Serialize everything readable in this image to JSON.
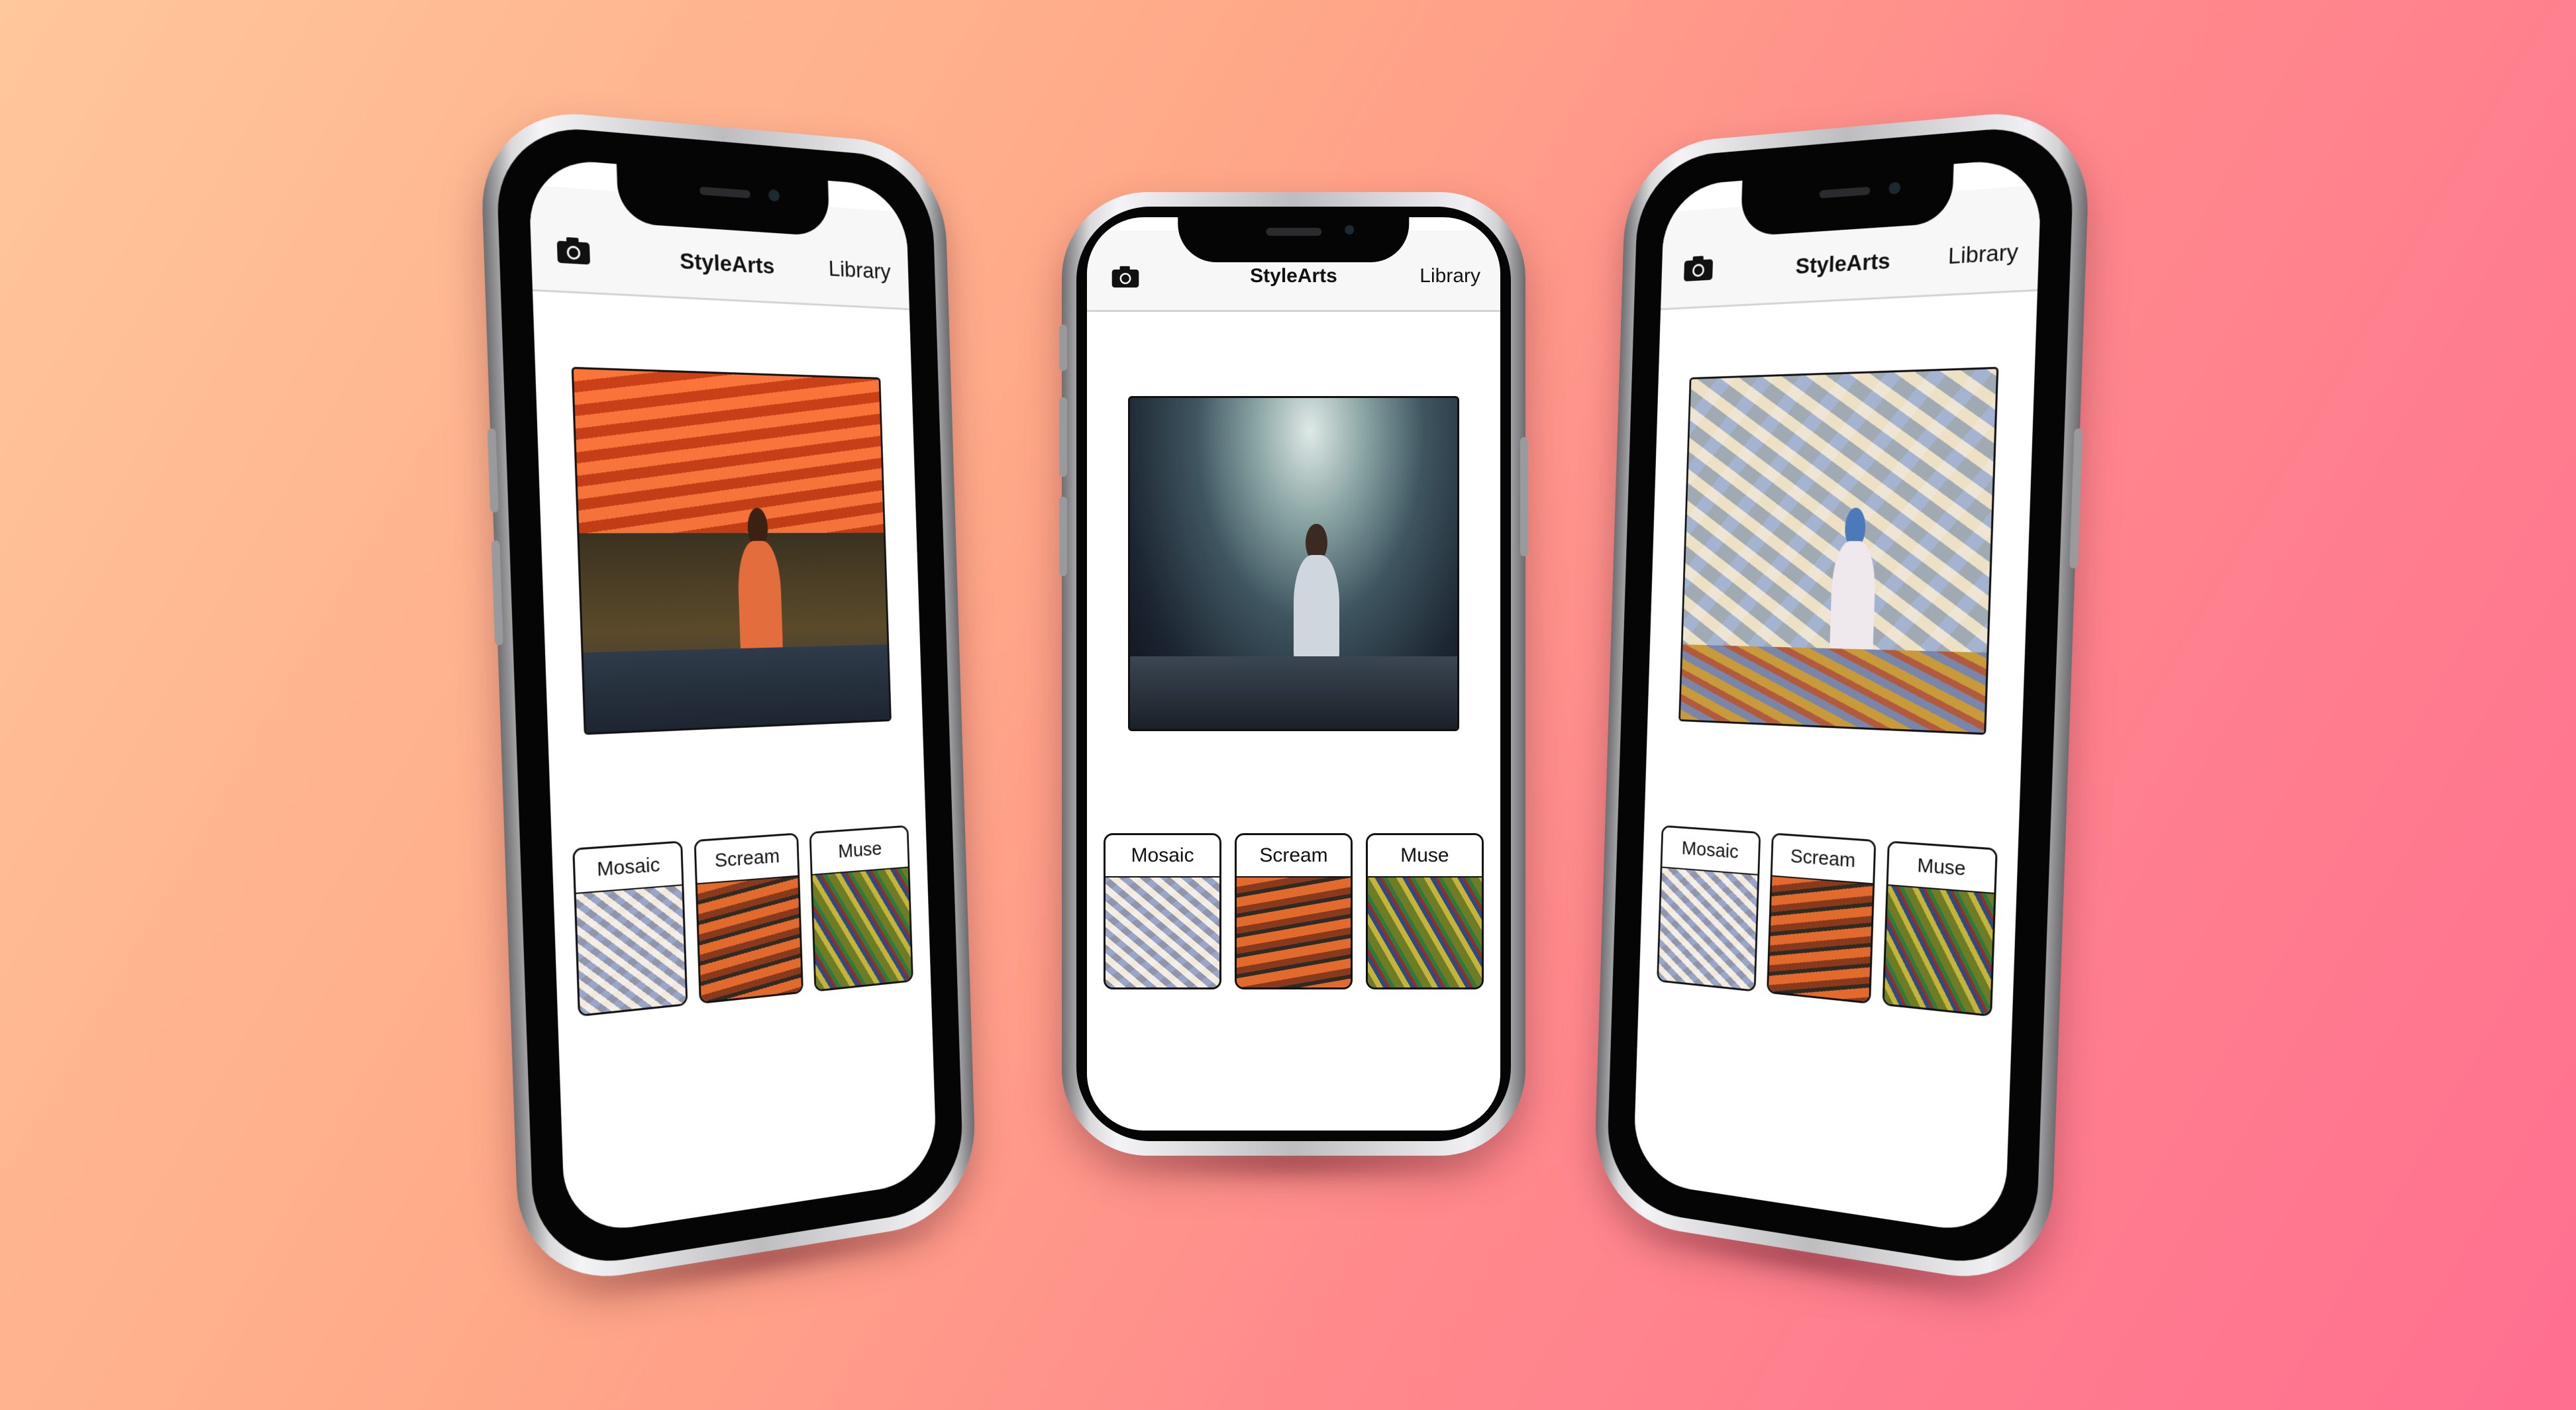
{
  "app": {
    "title": "StyleArts",
    "library_label": "Library",
    "camera_icon": "camera-icon"
  },
  "style_options": [
    {
      "label": "Mosaic"
    },
    {
      "label": "Scream"
    },
    {
      "label": "Muse"
    }
  ],
  "phones": [
    {
      "id": "left",
      "applied_style": "Scream"
    },
    {
      "id": "center",
      "applied_style": ""
    },
    {
      "id": "right",
      "applied_style": "Mosaic"
    }
  ],
  "colors": {
    "background_start": "#ffc79a",
    "background_end": "#ff6f90",
    "nav_background": "#f7f7f7",
    "text": "#111111"
  }
}
